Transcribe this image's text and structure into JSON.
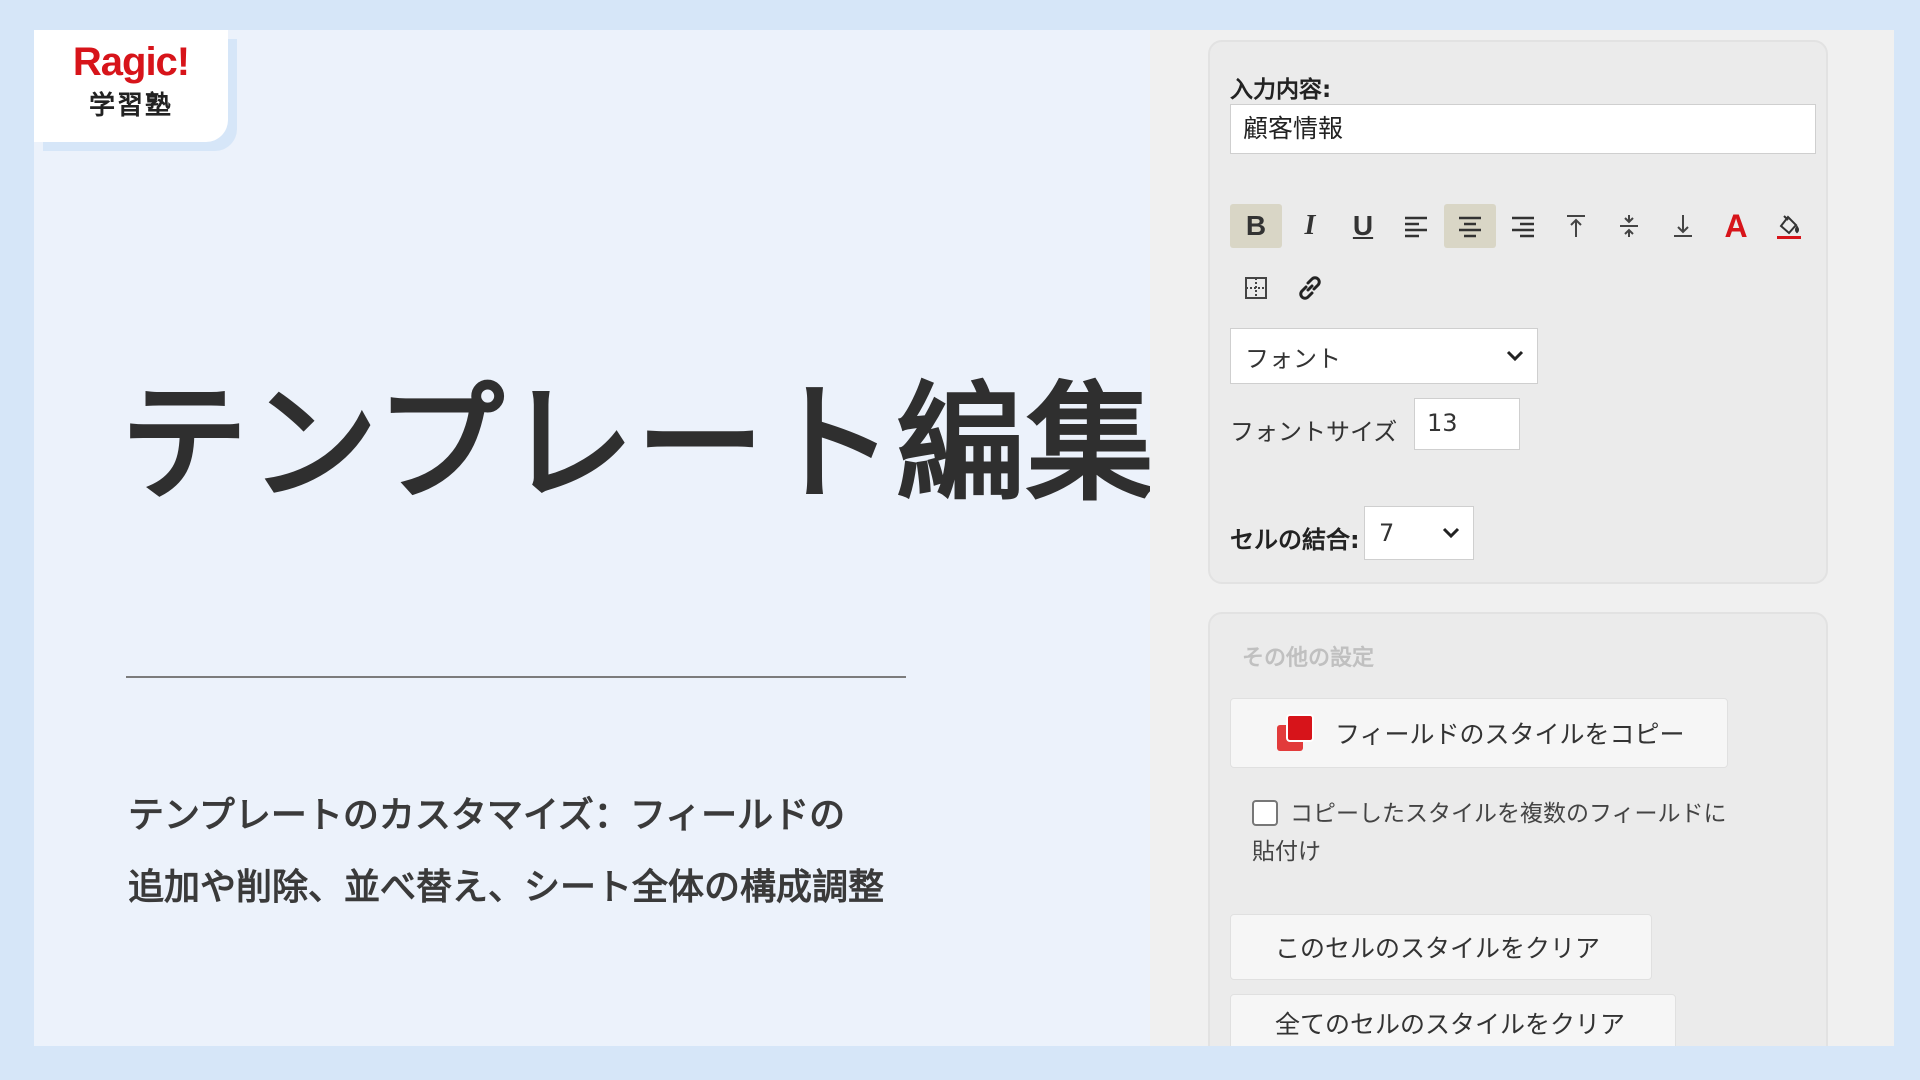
{
  "brand": {
    "name": "Ragic!",
    "sub": "学習塾"
  },
  "headline": "テンプレート編集",
  "description": {
    "line1": "テンプレートのカスタマイズ：フィールドの",
    "line2": "追加や削除、並べ替え、シート全体の構成調整"
  },
  "panel": {
    "input_label": "入力内容:",
    "input_value": "顧客情報",
    "toolbar": [
      {
        "icon": "bold-icon",
        "glyph": "B",
        "active": true
      },
      {
        "icon": "italic-icon",
        "glyph": "I",
        "active": false
      },
      {
        "icon": "underline-icon",
        "glyph": "U",
        "active": false
      },
      {
        "icon": "align-left-icon",
        "active": false
      },
      {
        "icon": "align-center-icon",
        "active": true
      },
      {
        "icon": "align-right-icon",
        "active": false
      },
      {
        "icon": "valign-top-icon",
        "active": false
      },
      {
        "icon": "valign-middle-icon",
        "active": false
      },
      {
        "icon": "valign-bottom-icon",
        "active": false
      },
      {
        "icon": "font-color-icon",
        "glyph": "A",
        "active": false
      },
      {
        "icon": "fill-color-icon",
        "active": false
      },
      {
        "icon": "border-icon",
        "active": false
      },
      {
        "icon": "link-icon",
        "active": false
      }
    ],
    "font_select": "フォント",
    "font_size_label": "フォントサイズ",
    "font_size_value": "13",
    "merge_label": "セルの結合:",
    "merge_value": "7",
    "other_settings_title": "その他の設定",
    "copy_style_button": "フィールドのスタイルをコピー",
    "paste_multiple_line1": "コピーしたスタイルを複数のフィールドに",
    "paste_multiple_line2": "貼付け",
    "clear_cell_button": "このセルのスタイルをクリア",
    "clear_all_button": "全てのセルのスタイルをクリア"
  },
  "colors": {
    "accent_red": "#d7141a",
    "background": "#d6e6f8",
    "card": "#ecf2fb"
  }
}
